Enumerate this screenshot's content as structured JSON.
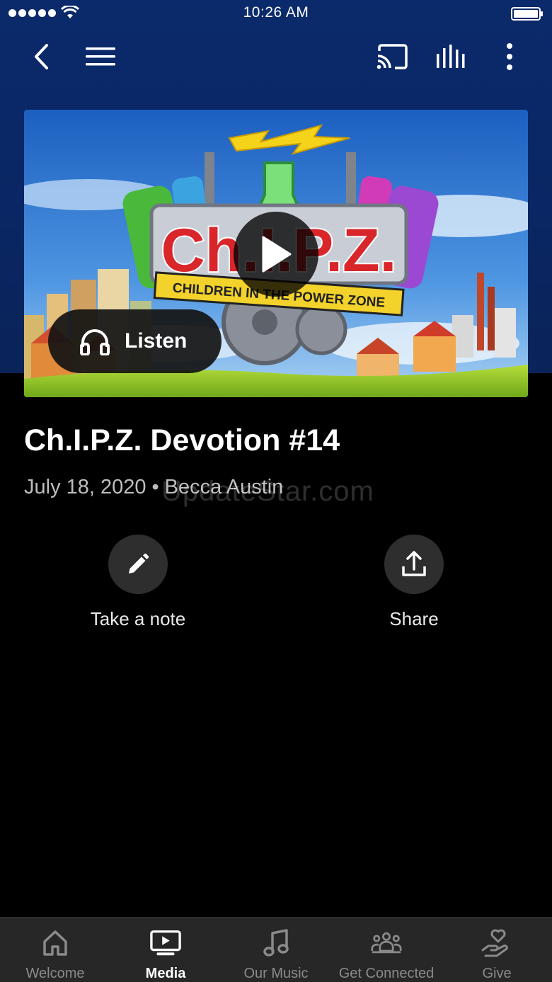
{
  "status_bar": {
    "time": "10:26 AM"
  },
  "media": {
    "title": "Ch.I.P.Z. Devotion #14",
    "date": "July 18, 2020",
    "author": "Becca Austin",
    "watermark": "UpdateStar.com",
    "listen_label": "Listen",
    "artwork_text": {
      "logo": "Ch.I.P.Z.",
      "tagline": "CHILDREN IN THE POWER ZONE"
    }
  },
  "actions": [
    {
      "label": "Take a note",
      "icon": "pencil-icon"
    },
    {
      "label": "Share",
      "icon": "share-icon"
    }
  ],
  "tabs": [
    {
      "label": "Welcome",
      "icon": "home-icon",
      "active": false
    },
    {
      "label": "Media",
      "icon": "tv-play-icon",
      "active": true
    },
    {
      "label": "Our Music",
      "icon": "music-note-icon",
      "active": false
    },
    {
      "label": "Get Connected",
      "icon": "people-icon",
      "active": false
    },
    {
      "label": "Give",
      "icon": "heart-hand-icon",
      "active": false
    }
  ],
  "colors": {
    "header": "#0b2a6b",
    "background": "#000000",
    "tabbar": "#272727",
    "muted_text": "#bdbdbd"
  }
}
